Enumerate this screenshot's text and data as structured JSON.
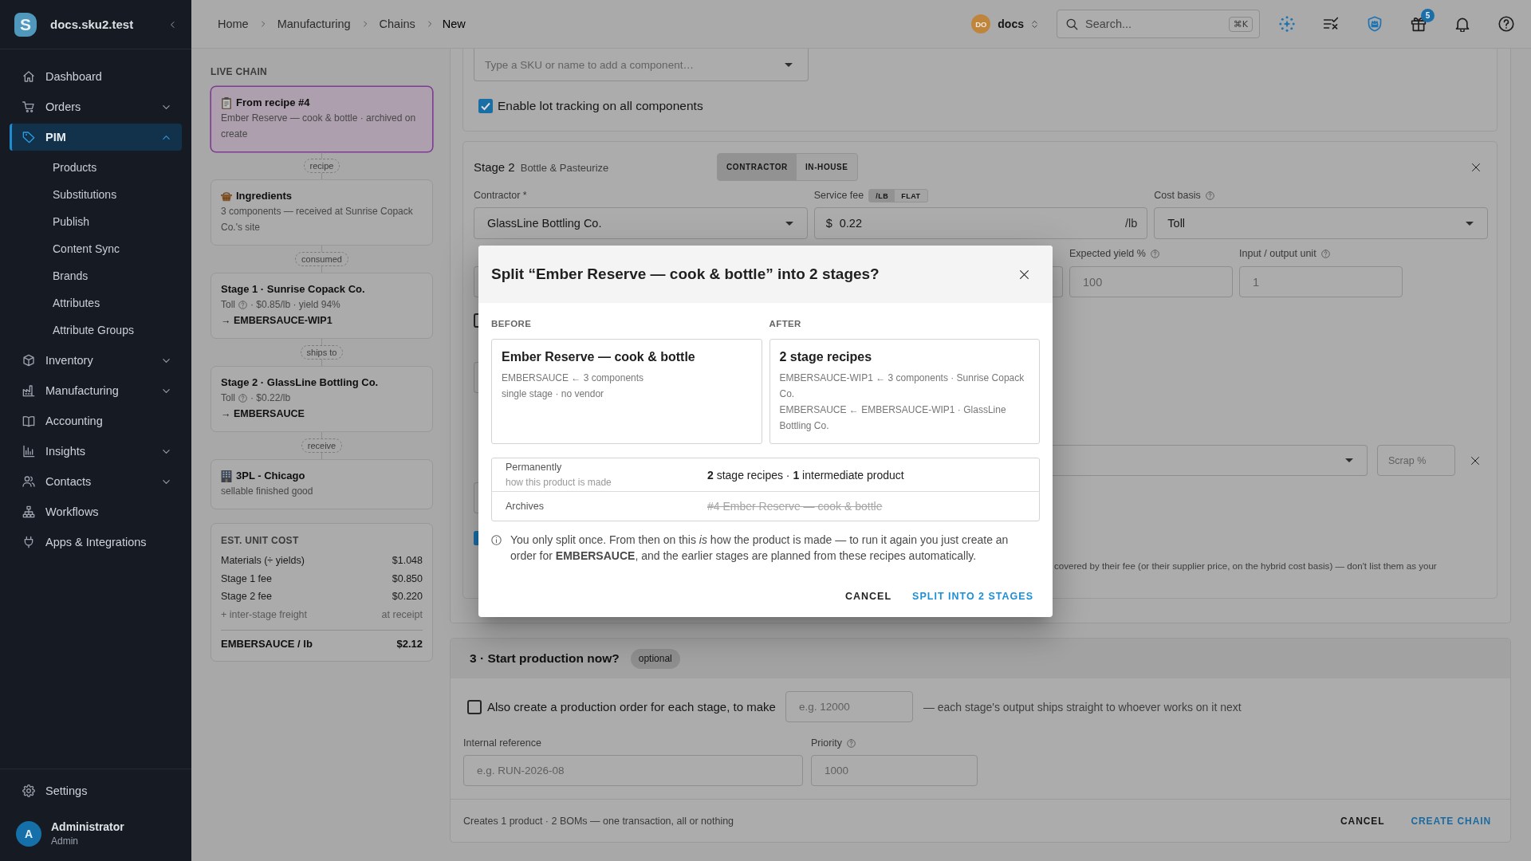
{
  "sidebar": {
    "logo": "S",
    "workspace": "docs.sku2.test",
    "items": [
      {
        "label": "Dashboard",
        "kind": "link",
        "selected": false
      },
      {
        "label": "Orders",
        "kind": "group",
        "selected": false,
        "expanded": false
      },
      {
        "label": "PIM",
        "kind": "group",
        "selected": true,
        "expanded": true,
        "children": [
          {
            "label": "Products",
            "selected": false
          },
          {
            "label": "Substitutions",
            "selected": false
          },
          {
            "label": "Publish",
            "selected": false
          },
          {
            "label": "Content Sync",
            "selected": false
          },
          {
            "label": "Brands",
            "selected": false
          },
          {
            "label": "Attributes",
            "selected": false
          },
          {
            "label": "Attribute Groups",
            "selected": false
          }
        ]
      },
      {
        "label": "Inventory",
        "kind": "group",
        "selected": false,
        "expanded": false
      },
      {
        "label": "Manufacturing",
        "kind": "group",
        "selected": false,
        "expanded": false
      },
      {
        "label": "Accounting",
        "kind": "link",
        "selected": false
      },
      {
        "label": "Insights",
        "kind": "group",
        "selected": false,
        "expanded": false
      },
      {
        "label": "Contacts",
        "kind": "group",
        "selected": false,
        "expanded": false
      },
      {
        "label": "Workflows",
        "kind": "link",
        "selected": false
      },
      {
        "label": "Apps & Integrations",
        "kind": "link",
        "selected": false
      }
    ],
    "settings": "Settings",
    "user": {
      "initial": "A",
      "name": "Administrator",
      "role": "Admin"
    }
  },
  "topbar": {
    "breadcrumbs": [
      {
        "label": "Home",
        "current": false
      },
      {
        "label": "Manufacturing",
        "current": false
      },
      {
        "label": "Chains",
        "current": false
      },
      {
        "label": "New",
        "current": true
      }
    ],
    "workspace": {
      "initials": "DO",
      "name": "docs"
    },
    "search": {
      "placeholder": "Search...",
      "shortcut": "⌘K"
    },
    "gift_badge": "5"
  },
  "live_chain": {
    "title": "LIVE CHAIN",
    "nodes": [
      {
        "kind": "recipe",
        "selected": true,
        "title": "From recipe #4",
        "detail": "Ember Reserve — cook & bottle · archived on create"
      },
      {
        "kind": "ingredients",
        "selected": false,
        "title": "Ingredients",
        "detail": "3 components — received at Sunrise Copack Co.'s site"
      },
      {
        "kind": "stage",
        "selected": false,
        "title": "Stage 1 · Sunrise Copack Co.",
        "basis": "Toll",
        "terms": "· $0.85/lb · yield 94%",
        "output": "→ EMBERSAUCE-WIP1"
      },
      {
        "kind": "stage",
        "selected": false,
        "title": "Stage 2 · GlassLine Bottling Co.",
        "basis": "Toll",
        "terms": "· $0.22/lb",
        "output": "→ EMBERSAUCE"
      },
      {
        "kind": "destination",
        "selected": false,
        "title": "3PL - Chicago",
        "detail": "sellable finished good"
      }
    ],
    "links": [
      "recipe",
      "consumed",
      "ships to",
      "receive"
    ],
    "cost": {
      "title": "EST. UNIT COST",
      "rows": [
        {
          "kind": "line",
          "label": "Materials (÷ yields)",
          "value": "$1.048"
        },
        {
          "kind": "line",
          "label": "Stage 1 fee",
          "value": "$0.850"
        },
        {
          "kind": "line",
          "label": "Stage 2 fee",
          "value": "$0.220"
        },
        {
          "kind": "note",
          "label": "+ inter-stage freight",
          "value": "at receipt"
        }
      ],
      "total": {
        "label": "EMBERSAUCE / lb",
        "value": "$2.12"
      }
    }
  },
  "section_2": {
    "stage_1": {
      "component_picker": {
        "placeholder": "Type a SKU or name to add a component…"
      },
      "lot_tracking": {
        "label": "Enable lot tracking on all components",
        "checked": true
      }
    },
    "stage_2": {
      "title": "Stage 2",
      "subtitle": "Bottle & Pasteurize",
      "modes": [
        {
          "label": "CONTRACTOR",
          "selected": true
        },
        {
          "label": "IN-HOUSE",
          "selected": false
        }
      ],
      "contractor": {
        "label": "Contractor *",
        "value": "GlassLine Bottling Co."
      },
      "service_fee": {
        "label": "Service fee",
        "units": [
          {
            "label": "/LB",
            "selected": true
          },
          {
            "label": "FLAT",
            "selected": false
          }
        ],
        "currency": "$",
        "value": "0.22",
        "suffix": "/lb"
      },
      "cost_basis": {
        "label": "Cost basis",
        "value": "Toll"
      },
      "covered_rows": [
        {
          "kind": "fields",
          "fields": [
            {
              "label": "Expected yield %",
              "placeholder": "100"
            },
            {
              "label": "Input / output unit",
              "placeholder": "1"
            }
          ]
        },
        {
          "kind": "checkbox",
          "checked": false
        },
        {
          "kind": "field"
        },
        {
          "kind": "component",
          "scrap_placeholder": "Scrap %"
        },
        {
          "kind": "field"
        },
        {
          "kind": "checkbox",
          "checked": true
        },
        {
          "kind": "note",
          "visible_tail": "covered by their fee (or their supplier price, on the hybrid cost basis) — don't list them as your"
        }
      ]
    }
  },
  "section_3": {
    "title": "3 · Start production now?",
    "badge": "optional",
    "create_orders": {
      "label": "Also create a production order for each stage, to make",
      "checked": false,
      "placeholder": "e.g. 12000",
      "trailing": "— each stage's output ships straight to whoever works on it next"
    },
    "internal_reference": {
      "label": "Internal reference",
      "placeholder": "e.g. RUN-2026-08"
    },
    "priority": {
      "label": "Priority",
      "placeholder": "1000"
    },
    "summary": "Creates 1 product · 2 BOMs — one transaction, all or nothing",
    "buttons": [
      {
        "label": "CANCEL",
        "kind": "text"
      },
      {
        "label": "CREATE CHAIN",
        "kind": "primary"
      }
    ]
  },
  "dialog": {
    "title": "Split “Ember Reserve — cook & bottle” into 2 stages?",
    "before": {
      "heading": "BEFORE",
      "title": "Ember Reserve — cook & bottle",
      "lines": [
        "EMBERSAUCE ← 3 components",
        "single stage · no vendor"
      ]
    },
    "after": {
      "heading": "AFTER",
      "title": "2 stage recipes",
      "lines": [
        "EMBERSAUCE-WIP1 ← 3 components · Sunrise Copack Co.",
        "EMBERSAUCE ← EMBERSAUCE-WIP1 · GlassLine Bottling Co."
      ]
    },
    "effects": [
      {
        "kind": "plain",
        "label": "Permanently",
        "hint": "how this product is made",
        "value": "**2** stage recipes · **1** intermediate product"
      },
      {
        "kind": "struck",
        "label": "Archives",
        "value": "#4 Ember Reserve — cook & bottle"
      }
    ],
    "note": "You only split once. From then on this *is* how the product is made — to run it again you just create an order for **EMBERSAUCE**, and the earlier stages are planned from these recipes automatically.",
    "buttons": [
      {
        "label": "CANCEL",
        "kind": "text"
      },
      {
        "label": "SPLIT INTO 2 STAGES",
        "kind": "primary"
      }
    ]
  }
}
